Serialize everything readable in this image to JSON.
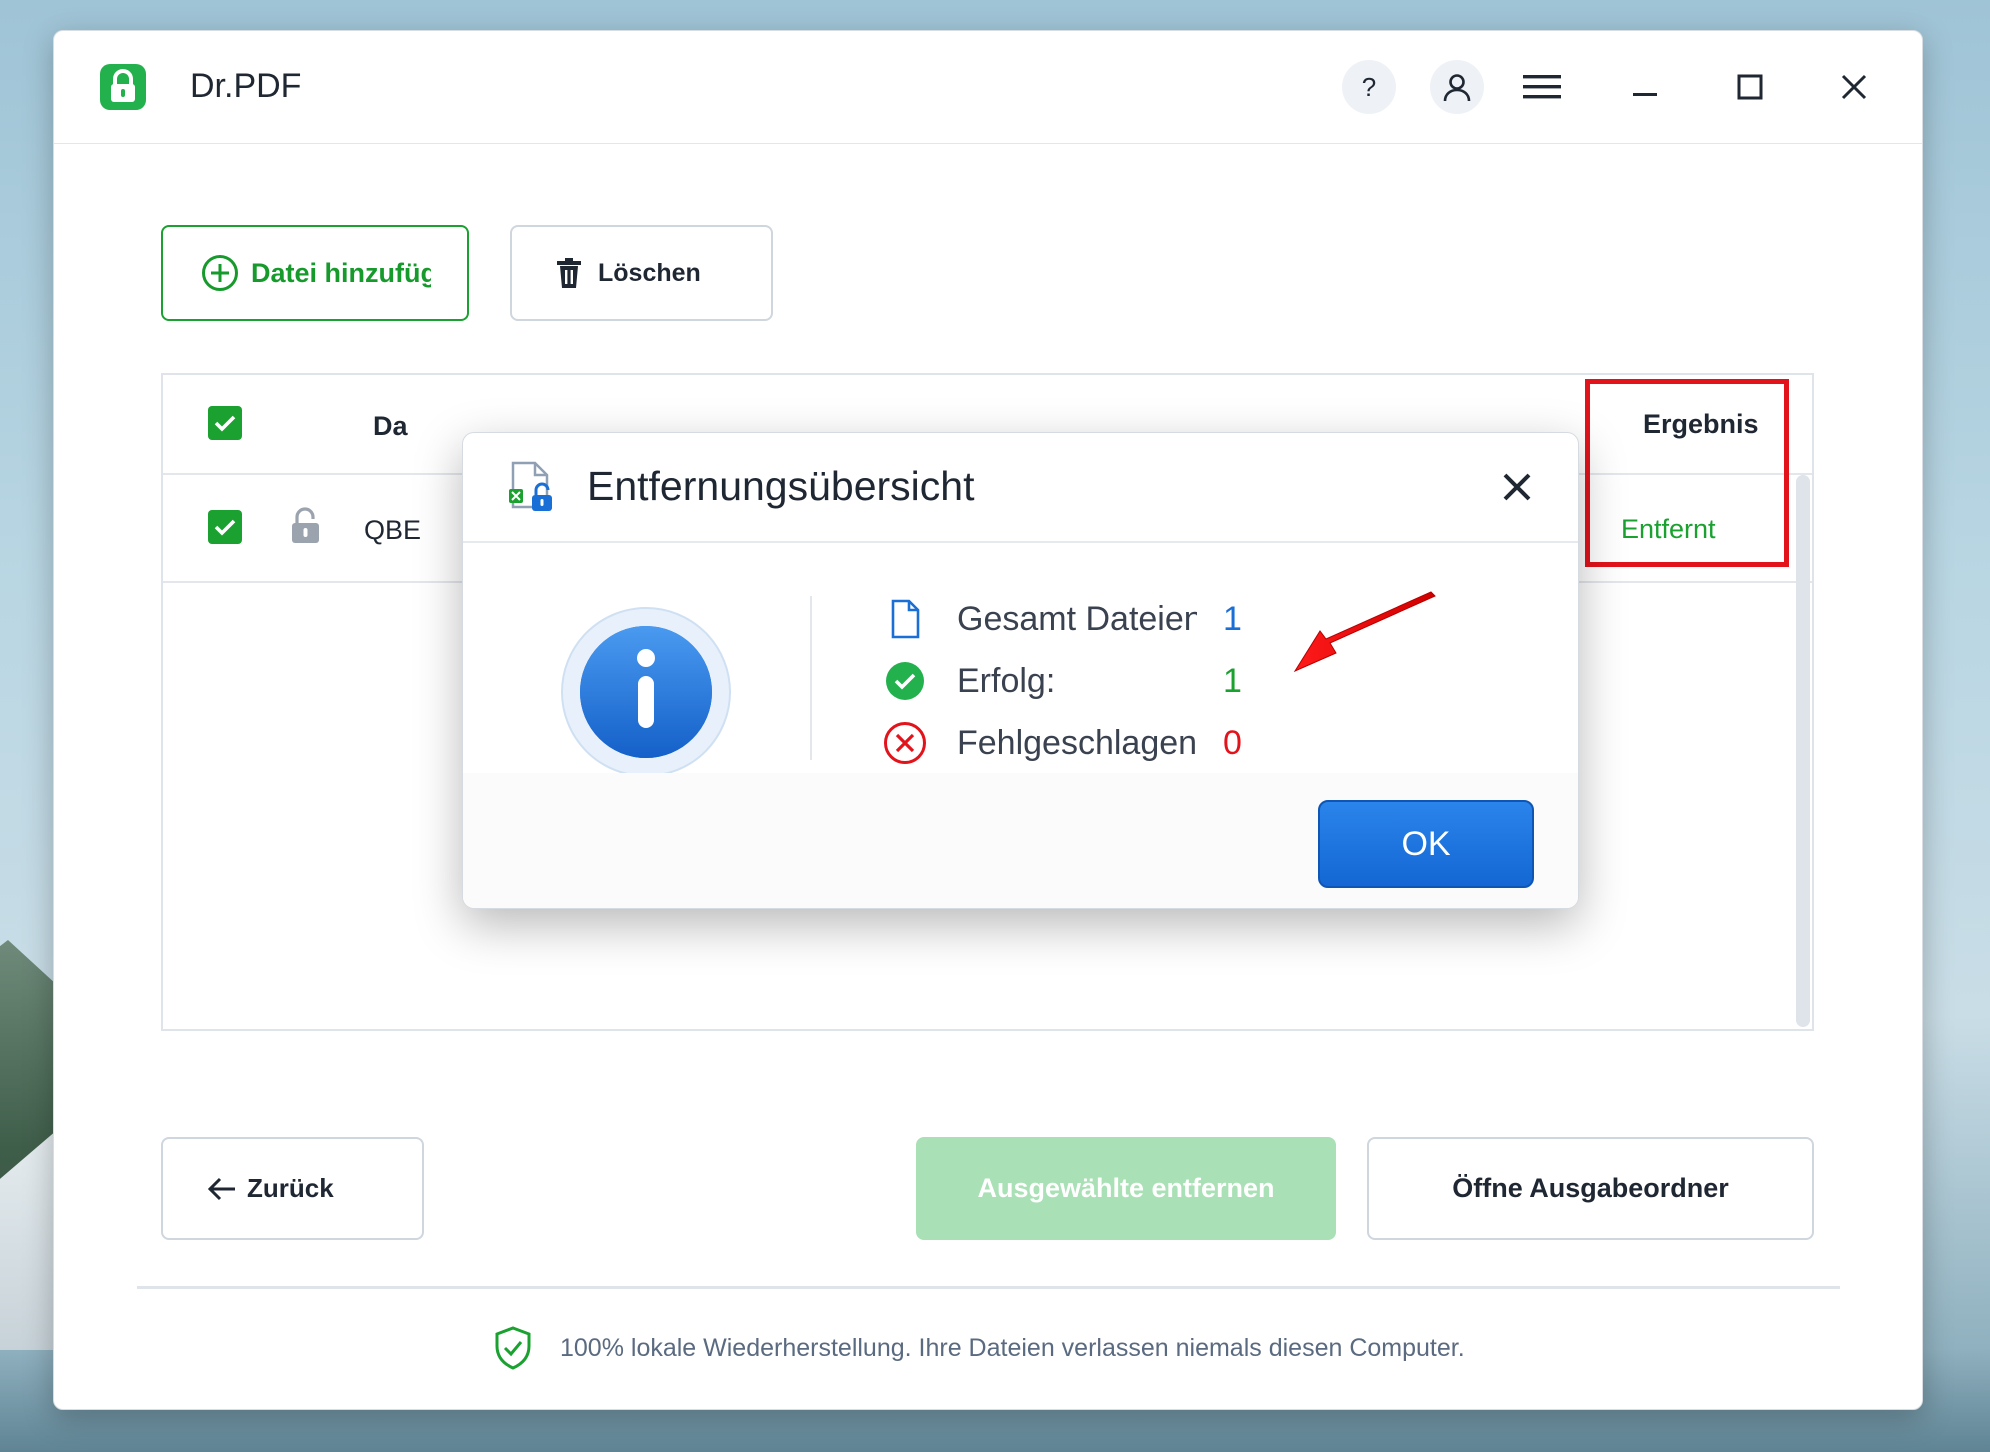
{
  "app": {
    "title": "Dr.PDF",
    "icons": {
      "logo": "lock-icon",
      "help": "help-icon",
      "account": "user-icon",
      "menu": "hamburger-menu-icon",
      "minimize": "minimize-icon",
      "maximize": "maximize-icon",
      "close": "close-icon"
    }
  },
  "toolbar": {
    "add_label": "Datei hinzufüg",
    "delete_label": "Löschen"
  },
  "table": {
    "headers": {
      "name": "Da",
      "result": "Ergebnis"
    },
    "rows": [
      {
        "name": "QBE",
        "result": "Entfernt",
        "status_icon": "unlock-icon"
      }
    ]
  },
  "dialog": {
    "title": "Entfernungsübersicht",
    "stats": [
      {
        "label": "Gesamt Dateien",
        "value": "1",
        "color": "#1a6fd6",
        "icon": "file-icon"
      },
      {
        "label": "Erfolg:",
        "value": "1",
        "color": "#1aa130",
        "icon": "success-check-icon"
      },
      {
        "label": "Fehlgeschlagen",
        "value": "0",
        "color": "#e3131b",
        "icon": "error-x-icon"
      }
    ],
    "ok_label": "OK"
  },
  "bottom": {
    "back_label": "Zurück",
    "remove_label": "Ausgewählte entfernen",
    "open_folder_label": "Öffne Ausgabeordner"
  },
  "footer": {
    "text": "100% lokale Wiederherstellung. Ihre Dateien verlassen niemals diesen Computer."
  },
  "colors": {
    "accent_green": "#1aa130",
    "primary_blue": "#1a6fd6",
    "highlight_red": "#e3131b"
  }
}
